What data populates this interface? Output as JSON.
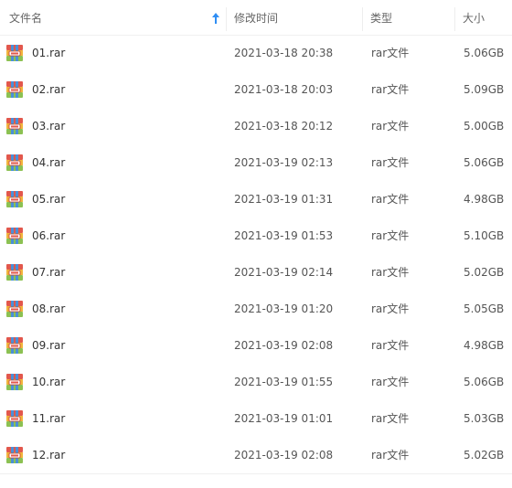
{
  "columns": {
    "name": "文件名",
    "modified": "修改时间",
    "type": "类型",
    "size": "大小"
  },
  "sort": {
    "column": "name",
    "direction": "ascending",
    "icon": "arrow-up-icon",
    "color": "#2f8ef4"
  },
  "file_icon": "archive-rar-icon",
  "files": [
    {
      "name": "01.rar",
      "modified": "2021-03-18 20:38",
      "type": "rar文件",
      "size": "5.06GB"
    },
    {
      "name": "02.rar",
      "modified": "2021-03-18 20:03",
      "type": "rar文件",
      "size": "5.09GB"
    },
    {
      "name": "03.rar",
      "modified": "2021-03-18 20:12",
      "type": "rar文件",
      "size": "5.00GB"
    },
    {
      "name": "04.rar",
      "modified": "2021-03-19 02:13",
      "type": "rar文件",
      "size": "5.06GB"
    },
    {
      "name": "05.rar",
      "modified": "2021-03-19 01:31",
      "type": "rar文件",
      "size": "4.98GB"
    },
    {
      "name": "06.rar",
      "modified": "2021-03-19 01:53",
      "type": "rar文件",
      "size": "5.10GB"
    },
    {
      "name": "07.rar",
      "modified": "2021-03-19 02:14",
      "type": "rar文件",
      "size": "5.02GB"
    },
    {
      "name": "08.rar",
      "modified": "2021-03-19 01:20",
      "type": "rar文件",
      "size": "5.05GB"
    },
    {
      "name": "09.rar",
      "modified": "2021-03-19 02:08",
      "type": "rar文件",
      "size": "4.98GB"
    },
    {
      "name": "10.rar",
      "modified": "2021-03-19 01:55",
      "type": "rar文件",
      "size": "5.06GB"
    },
    {
      "name": "11.rar",
      "modified": "2021-03-19 01:01",
      "type": "rar文件",
      "size": "5.03GB"
    },
    {
      "name": "12.rar",
      "modified": "2021-03-19 02:08",
      "type": "rar文件",
      "size": "5.02GB"
    }
  ]
}
